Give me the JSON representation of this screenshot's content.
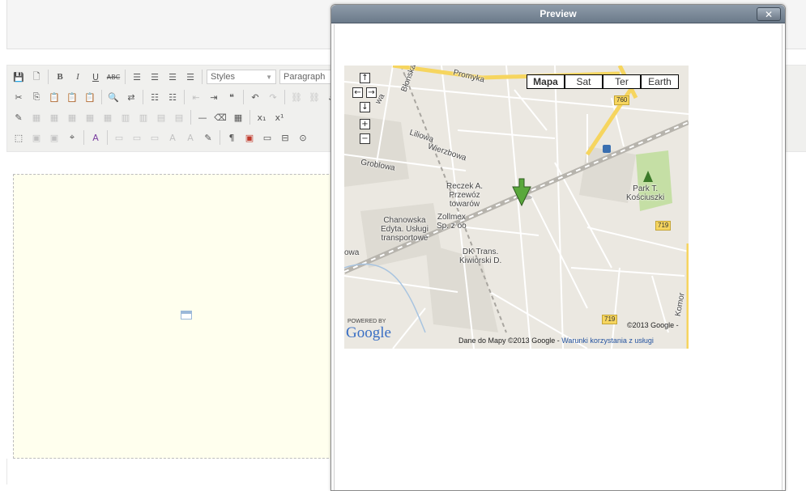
{
  "toolbar": {
    "styles_label": "Styles",
    "format_label": "Paragraph"
  },
  "preview": {
    "title": "Preview",
    "close_label": "✕"
  },
  "map": {
    "type_buttons": [
      "Mapa",
      "Sat",
      "Ter",
      "Earth"
    ],
    "active_type": "Mapa",
    "labels": {
      "promyka": "Promyka",
      "blonska": "Błońska",
      "liliowa": "Liliowa",
      "wierzbowa": "Wierzbowa",
      "groblowa": "Groblowa",
      "reczek": "Reczek A.\nPrzewóz\ntowarów",
      "chanowska": "Chanowska\nEdyta. Usługi\ntransportowe",
      "zollmex": "Zollmex\nSp. z oo",
      "dk_trans": "DK Trans.\nKiwiorski D.",
      "park": "Park T.\nKościuszki",
      "nowa": "owa",
      "komor": "Komor",
      "wa": "wa"
    },
    "road_numbers": [
      "760",
      "719",
      "719"
    ],
    "powered_by": "POWERED BY",
    "google_logo": "Google",
    "copyright": "©2013 Google -",
    "attribution_text": "Dane do Mapy ©2013 Google - ",
    "terms_link": "Warunki korzystania z usługi",
    "nav_controls": {
      "up": "↑",
      "left": "←",
      "right": "→",
      "down": "↓",
      "zoom_in": "+",
      "zoom_out": "−"
    }
  },
  "colors": {
    "editor_bg": "#ffffee",
    "titlebar": "#7a8796",
    "map_bg": "#ebe8e1",
    "major_road": "#f6d55f",
    "park_green": "#c5dfa5",
    "marker_green": "#5aa83c",
    "link_blue": "#2554a0"
  }
}
